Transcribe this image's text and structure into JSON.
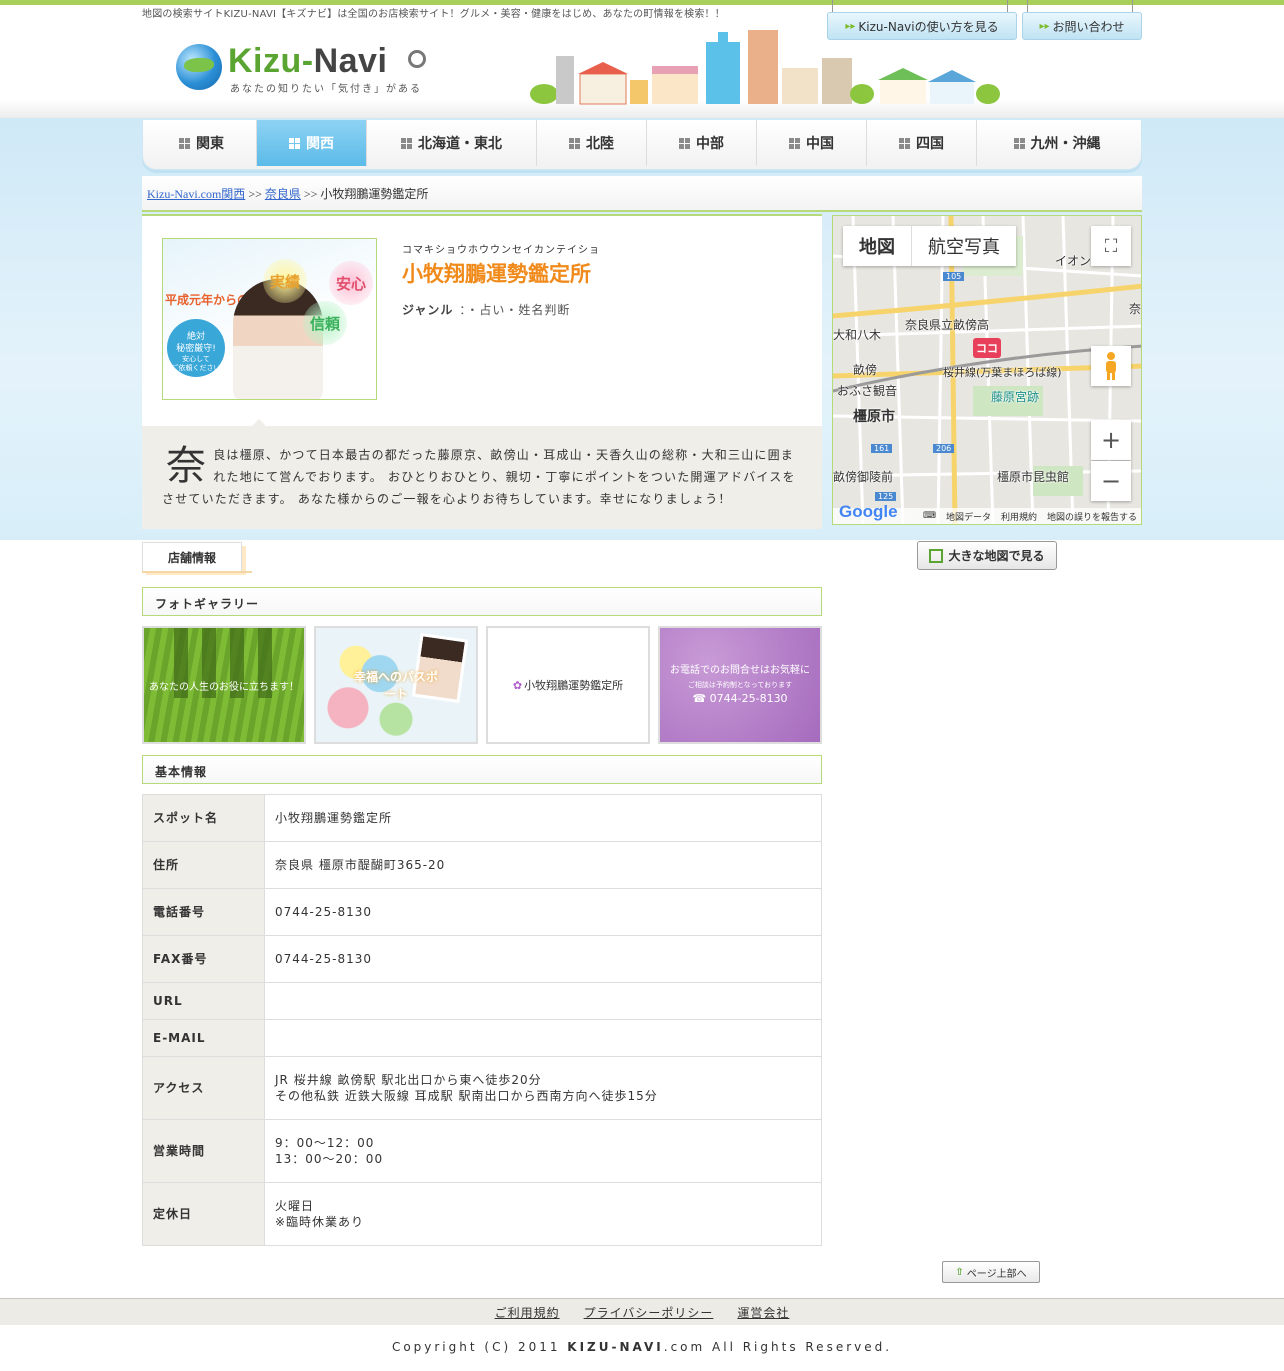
{
  "header": {
    "tagline": "地図の検索サイトKIZU-NAVI【キズナビ】は全国のお店検索サイト！グルメ・美容・健康をはじめ、あなたの町情報を検索！！",
    "logo_main": "Kizu-",
    "logo_navi": "Navi",
    "logo_sub": "あなたの知りたい「気付き」がある",
    "howto_button": "Kizu-Naviの使い方を見る",
    "contact_button": "お問い合わせ"
  },
  "nav": {
    "items": [
      {
        "label": "関東",
        "active": false
      },
      {
        "label": "関西",
        "active": true
      },
      {
        "label": "北海道・東北",
        "active": false
      },
      {
        "label": "北陸",
        "active": false
      },
      {
        "label": "中部",
        "active": false
      },
      {
        "label": "中国",
        "active": false
      },
      {
        "label": "四国",
        "active": false
      },
      {
        "label": "九州・沖縄",
        "active": false
      }
    ]
  },
  "breadcrumb": {
    "home": "Kizu-Navi.com関西",
    "sep": ">>",
    "pref": "奈良県",
    "current": "小牧翔鵬運勢鑑定所"
  },
  "shop": {
    "kana": "コマキショウホウウンセイカンテイショ",
    "name": "小牧翔鵬運勢鑑定所",
    "genre_label": "ジャンル",
    "genre_value": "：・占い・姓名判断",
    "desc_initial": "奈",
    "desc_rest": "良は橿原、かつて日本最古の都だった藤原京、畝傍山・耳成山・天香久山の総称・大和三山に囲まれた地にて営んでおります。 おひとりおひとり、親切・丁寧にポイントをついた開運アドバイスをさせていただきます。 あなた様からのご一報を心よりお待ちしています。幸せになりましょう！",
    "hero": {
      "since": "平成元年からの",
      "bubble1": "実績",
      "bubble2": "安心",
      "bubble3": "信頼",
      "seal_line1": "絶対",
      "seal_line2": "秘密厳守!",
      "seal_line3": "安心して",
      "seal_line4": "ご依頼ください"
    }
  },
  "map": {
    "tab_map": "地図",
    "tab_aerial": "航空写真",
    "labels": {
      "school": "奈良県立畝傍高",
      "line": "桜井線(万葉まほろば線)",
      "palace": "藤原宮跡",
      "city": "橿原市",
      "insect": "橿原市昆虫館",
      "station1": "大和八木",
      "station2": "畝傍御陵前",
      "kokko": "ココ",
      "osafusa": "おふさ観音",
      "unebi": "畝傍",
      "ion": "イオン",
      "r105": "105",
      "r161": "161",
      "r206": "206",
      "r125": "125",
      "nara": "奈"
    },
    "footer_data": "地図データ",
    "footer_terms": "利用規約",
    "footer_report": "地図の誤りを報告する",
    "google": "Google",
    "big_map_button": "大きな地図で見る"
  },
  "tabs": {
    "store_info": "店舗情報"
  },
  "gallery": {
    "title": "フォトギャラリー",
    "items": [
      {
        "caption": "あなたの人生のお役に立ちます！"
      },
      {
        "caption": "幸福へのパスポート"
      },
      {
        "caption": "小牧翔鵬運勢鑑定所"
      },
      {
        "caption": "お電話でのお問合せはお気軽に",
        "sub": "ご相談は予約制となっております",
        "phone": "☎ 0744-25-8130"
      }
    ]
  },
  "basic": {
    "title": "基本情報",
    "rows": [
      {
        "key": "スポット名",
        "lines": [
          "小牧翔鵬運勢鑑定所"
        ]
      },
      {
        "key": "住所",
        "lines": [
          "奈良県 橿原市醍醐町365-20"
        ]
      },
      {
        "key": "電話番号",
        "lines": [
          "0744-25-8130"
        ]
      },
      {
        "key": "FAX番号",
        "lines": [
          "0744-25-8130"
        ]
      },
      {
        "key": "URL",
        "lines": [
          ""
        ]
      },
      {
        "key": "E-MAIL",
        "lines": [
          ""
        ]
      },
      {
        "key": "アクセス",
        "lines": [
          "JR 桜井線 畝傍駅 駅北出口から東へ徒歩20分",
          "その他私鉄 近鉄大阪線 耳成駅 駅南出口から西南方向へ徒歩15分"
        ]
      },
      {
        "key": "営業時間",
        "lines": [
          "9：00～12：00",
          "13：00～20：00"
        ]
      },
      {
        "key": "定休日",
        "lines": [
          "火曜日",
          "※臨時休業あり"
        ]
      }
    ]
  },
  "page_top": "ページ上部へ",
  "footer": {
    "links": [
      "ご利用規約",
      "プライバシーポリシー",
      "運営会社"
    ],
    "copyright_pre": "Copyright (C) 2011 ",
    "copyright_brand": "KIZU-NAVI",
    "copyright_post": ".com All Rights Reserved."
  },
  "colors": {
    "accent_green": "#a9cf5b",
    "title_orange": "#f08a1b",
    "nav_active": "#5bbbe8"
  }
}
